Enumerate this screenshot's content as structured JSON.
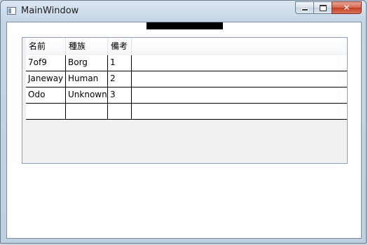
{
  "window": {
    "title": "MainWindow",
    "buttons": {
      "close": "✕"
    }
  },
  "grid": {
    "columns": [
      "名前",
      "種族",
      "備考"
    ],
    "rows": [
      [
        "7of9",
        "Borg",
        "1"
      ],
      [
        "Janeway",
        "Human",
        "2"
      ],
      [
        "Odo",
        "Unknown",
        "3"
      ],
      [
        "",
        "",
        ""
      ]
    ]
  },
  "colors": {
    "titlebar": "#c5d5e6",
    "close_button": "#c23d22",
    "grid_border": "#8aa0b8",
    "grid_background": "#f0f0f0",
    "redaction_bar": "#000000"
  }
}
